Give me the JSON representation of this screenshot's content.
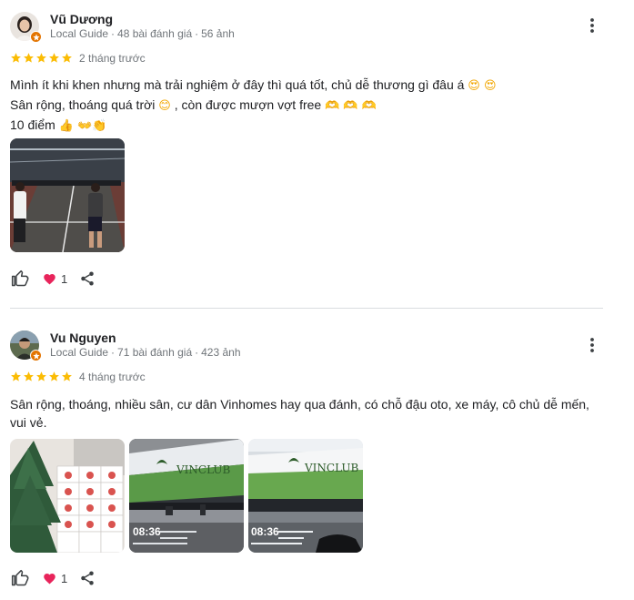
{
  "reviews": [
    {
      "name": "Vũ Dương",
      "guide": "Local Guide",
      "reviews_count": "48 bài đánh giá",
      "photos_count": "56 ảnh",
      "rating": 5,
      "time": "2 tháng trước",
      "lines": [
        "Mình ít khi khen nhưng mà trải nghiệm ở đây thì quá tốt, chủ dễ thương gì đâu á",
        "Sân rộng, thoáng quá trời",
        ", còn được mượn vợt free",
        "10 điểm"
      ],
      "emoji": {
        "line1": "😍 😍",
        "line2a": "😊",
        "line2b": "🫶 🫶 🫶",
        "line3": "👍 👐👏"
      },
      "reactions": "1"
    },
    {
      "name": "Vu Nguyen",
      "guide": "Local Guide",
      "reviews_count": "71 bài đánh giá",
      "photos_count": "423 ảnh",
      "rating": 5,
      "time": "4 tháng trước",
      "text": "Sân rộng, thoáng, nhiều sân, cư dân Vinhomes hay qua đánh, có chỗ đậu oto, xe máy, cô chủ dễ mến, vui vẻ.",
      "reactions": "1",
      "photo_sign": "VINCLUB",
      "photo_time": "08:36"
    }
  ],
  "colors": {
    "star": "#fbbc04",
    "heart": "#e8245b",
    "guide_badge": "#e37400",
    "muted": "#70757a"
  },
  "icons": [
    "more-vert-icon",
    "star-icon",
    "thumb-up-icon",
    "heart-icon",
    "share-icon",
    "local-guide-badge-icon"
  ]
}
